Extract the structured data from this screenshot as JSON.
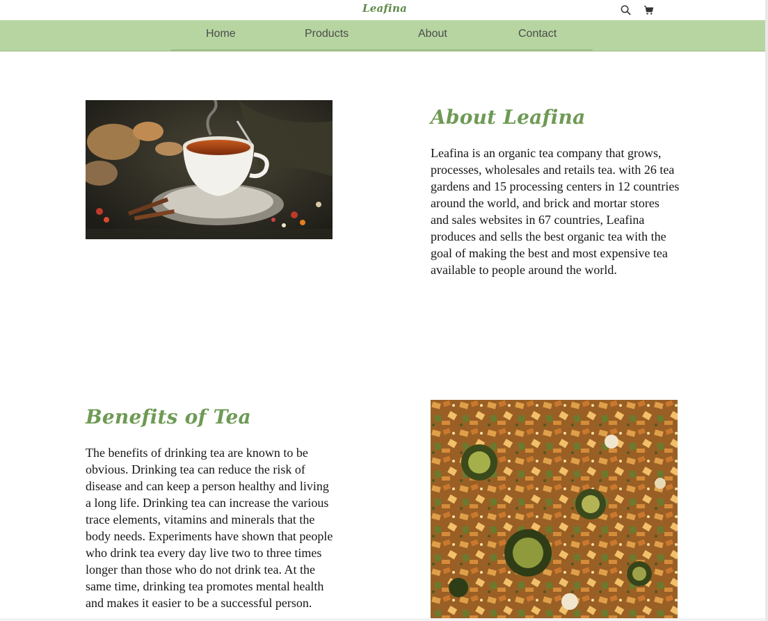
{
  "header": {
    "brand": "Leafina",
    "icons": [
      "search-icon",
      "cart-icon"
    ]
  },
  "nav": {
    "items": [
      {
        "label": "Home"
      },
      {
        "label": "Products"
      },
      {
        "label": "About"
      },
      {
        "label": "Contact"
      }
    ]
  },
  "about": {
    "title": "About Leafina",
    "body": "Leafina is an organic tea company that grows, processes, wholesales and retails tea. with 26 tea gardens and 15 processing centers in 12 countries around the world, and brick and mortar stores and sales websites in 67 countries, Leafina produces and sells the best organic tea with the goal of making the best and most expensive tea available to people around the world."
  },
  "benefits": {
    "title": "Benefits of Tea",
    "body": "The benefits of drinking tea are known to be obvious. Drinking tea can reduce the risk of disease and can keep a person healthy and living a long life. Drinking tea can increase the various trace elements, vitamins and minerals that the body needs. Experiments have shown that people who drink tea every day live two to three times longer than those who do not drink tea. At the same time, drinking tea promotes mental health and makes it easier to be a successful person."
  },
  "colors": {
    "brand_green": "#6e9a55",
    "nav_green": "#b7d5a1",
    "nav_text": "#4b4b4b"
  }
}
